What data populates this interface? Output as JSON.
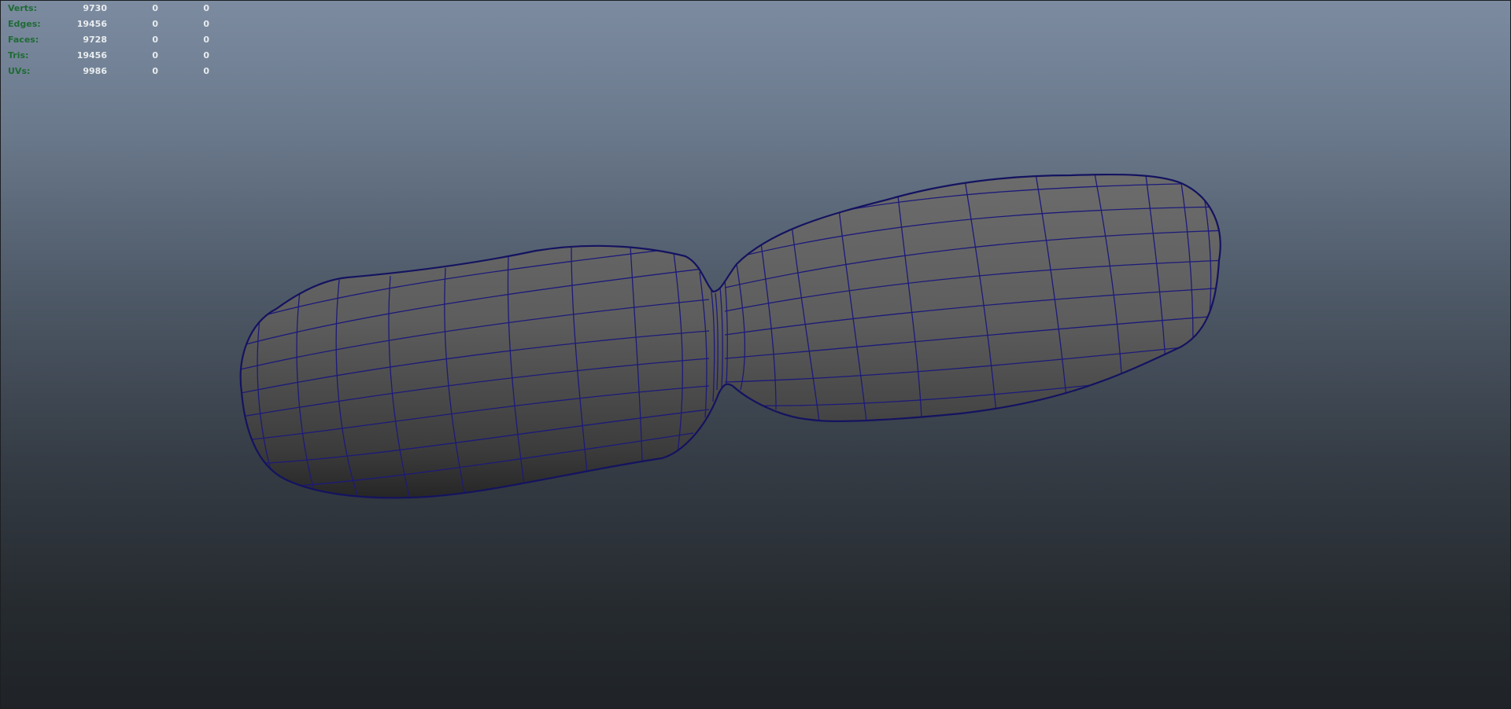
{
  "viewport": {
    "hud": {
      "rows": [
        {
          "label": "Verts:",
          "values": [
            "9730",
            "0",
            "0"
          ]
        },
        {
          "label": "Edges:",
          "values": [
            "19456",
            "0",
            "0"
          ]
        },
        {
          "label": "Faces:",
          "values": [
            "9728",
            "0",
            "0"
          ]
        },
        {
          "label": "Tris:",
          "values": [
            "19456",
            "0",
            "0"
          ]
        },
        {
          "label": "UVs:",
          "values": [
            "9986",
            "0",
            "0"
          ]
        }
      ]
    },
    "colors": {
      "label_green": "#1f6b35",
      "value_white": "#e8ecef",
      "wireframe": "#1c1a7a",
      "mesh_gray": "#5a5a5a"
    }
  }
}
